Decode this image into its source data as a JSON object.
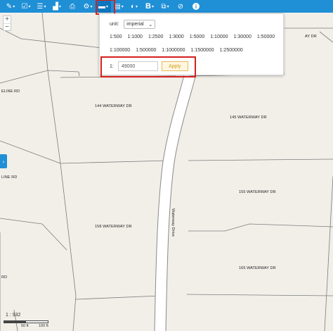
{
  "toolbar": {
    "icons": [
      "pencil-icon",
      "check-square-icon",
      "list-icon",
      "chart-icon",
      "print-icon",
      "share-icon",
      "scale-icon",
      "table-icon",
      "contrast-icon",
      "bold-icon",
      "copy-icon",
      "ban-icon",
      "info-icon"
    ],
    "bold_label": "B",
    "info_label": "i"
  },
  "zoom": {
    "in_label": "+",
    "out_label": "−"
  },
  "side_tab": {
    "label": "›"
  },
  "scale_popup": {
    "unit_label": "unit:",
    "unit_value": "imperial",
    "scales_row1": [
      "1:500",
      "1:1000",
      "1:2500",
      "1:3000",
      "1:5000",
      "1:10000",
      "1:30000",
      "1:50000"
    ],
    "scales_row2": [
      "1:100000",
      "1:500000",
      "1:1000000",
      "1:1500000",
      "1:2500000"
    ],
    "custom_prefix": "1:",
    "custom_value": "49000",
    "apply_label": "Apply"
  },
  "map": {
    "labels": {
      "parcel_144": "144 WATERWAY DR",
      "parcel_145": "145 WATERWAY DR",
      "parcel_155": "155 WATERWAY DR",
      "parcel_158": "158 WATERWAY DR",
      "parcel_165": "165 WATERWAY DR",
      "waterway_dr_right": "AY DR",
      "eline_rd_top": "ELINE RD",
      "line_rd": "LINE RD",
      "road_name": "Waterway Drive",
      "left_bottom": "RD"
    }
  },
  "scalebar": {
    "scale_text": "1 : 932",
    "tick_50": "50 ft",
    "tick_100": "100 ft"
  },
  "colors": {
    "toolbar": "#1f8fd6",
    "highlight": "#d6201e",
    "map_background": "#f2efe9",
    "road": "#ffffff",
    "apply_text": "#d39a1a"
  }
}
